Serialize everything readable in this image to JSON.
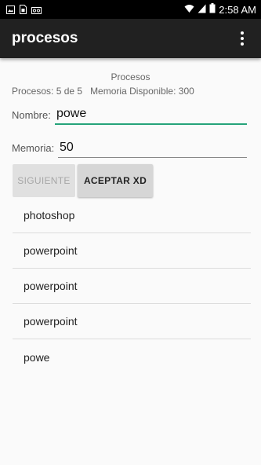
{
  "status_bar": {
    "time": "2:58 AM",
    "icons": [
      "image-icon",
      "sim-icon",
      "voicemail-icon",
      "wifi-icon",
      "signal-icon",
      "battery-icon"
    ]
  },
  "app_bar": {
    "title": "procesos",
    "overflow_icon": "more-vert-icon"
  },
  "header": {
    "title": "Procesos",
    "processes": "Procesos: 5 de 5",
    "memory": "Memoria Disponible: 300"
  },
  "form": {
    "name_label": "Nombre:",
    "name_value": "powe",
    "memory_label": "Memoria:",
    "memory_value": "50",
    "focus_color": "#26a37a"
  },
  "buttons": {
    "next_label": "SIGUIENTE",
    "accept_label": "ACEPTAR XD"
  },
  "processes": [
    {
      "name": "photoshop"
    },
    {
      "name": "powerpoint"
    },
    {
      "name": "powerpoint"
    },
    {
      "name": "powerpoint"
    },
    {
      "name": "powe"
    }
  ]
}
